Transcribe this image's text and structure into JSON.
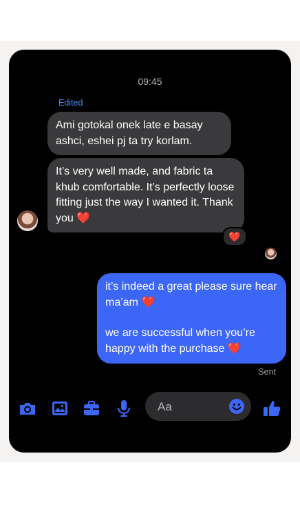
{
  "status": {
    "time": "09:45"
  },
  "thread": {
    "edited_label": "Edited",
    "incoming": [
      {
        "text": "Ami gotokal onek late e basay ashci, eshei pj ta try korlam."
      },
      {
        "text": "It’s very well made, and fabric ta khub comfortable. It’s perfectly loose fitting just the way I wanted it. Thank you",
        "emoji": "❤️",
        "reaction": "❤️"
      }
    ],
    "outgoing": {
      "line1": "it’s indeed a great please sure hear ma’am",
      "line1_emoji": "❤️",
      "line2": "we are successful when you’re happy with the purchase",
      "line2_emoji": "❤️",
      "status": "Sent"
    }
  },
  "composer": {
    "placeholder": "Aa",
    "icons": [
      "camera-icon",
      "photo-icon",
      "briefcase-icon",
      "microphone-icon",
      "emoji-icon",
      "thumbs-up-icon"
    ]
  },
  "colors": {
    "accent": "#3c66f6",
    "incoming_bubble": "#3a3a3c",
    "background": "#000000",
    "heart": "#f0223a"
  }
}
